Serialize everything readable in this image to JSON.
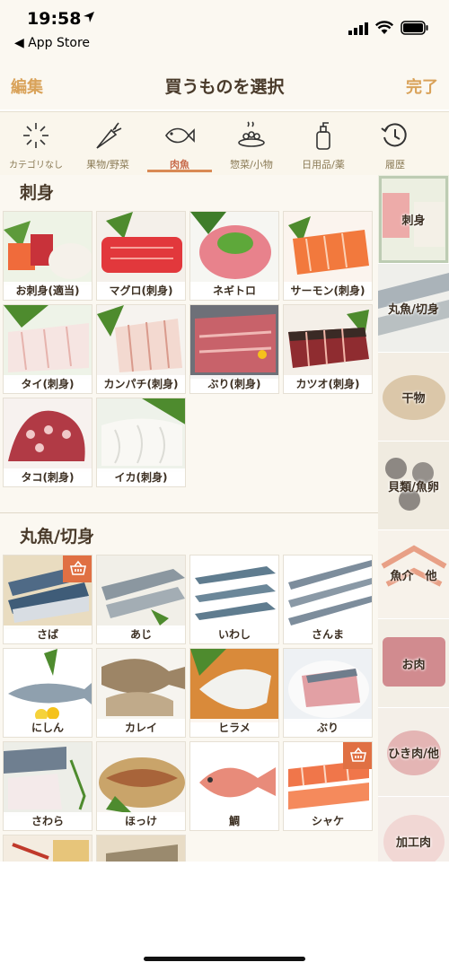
{
  "status": {
    "time": "19:58",
    "back_app": "◀ App Store"
  },
  "nav": {
    "left": "編集",
    "title": "買うものを選択",
    "right": "完了"
  },
  "tabs": [
    {
      "label": "カテゴリなし",
      "icon": "sparkle-icon"
    },
    {
      "label": "果物/野菜",
      "icon": "carrot-icon"
    },
    {
      "label": "肉魚",
      "icon": "fish-icon",
      "active": true
    },
    {
      "label": "惣菜/小物",
      "icon": "dish-icon"
    },
    {
      "label": "日用品/薬",
      "icon": "bottle-icon"
    },
    {
      "label": "履歴",
      "icon": "history-icon"
    }
  ],
  "sections": [
    {
      "title": "刺身",
      "items": [
        "お刺身(適当)",
        "マグロ(刺身)",
        "ネギトロ",
        "サーモン(刺身)",
        "タイ(刺身)",
        "カンパチ(刺身)",
        "ぶり(刺身)",
        "カツオ(刺身)",
        "タコ(刺身)",
        "イカ(刺身)"
      ]
    },
    {
      "title": "丸魚/切身",
      "items": [
        "さば",
        "あじ",
        "いわし",
        "さんま",
        "にしん",
        "カレイ",
        "ヒラメ",
        "ぶり",
        "さわら",
        "ほっけ",
        "鯛",
        "シャケ"
      ]
    }
  ],
  "sidebar": [
    "刺身",
    "丸魚/切身",
    "干物",
    "貝類/魚卵",
    "魚介　他",
    "お肉",
    "ひき肉/他",
    "加工肉"
  ],
  "colors": {
    "accent": "#d9a259",
    "cart": "#e07043",
    "active_tab": "#c86b4b"
  }
}
